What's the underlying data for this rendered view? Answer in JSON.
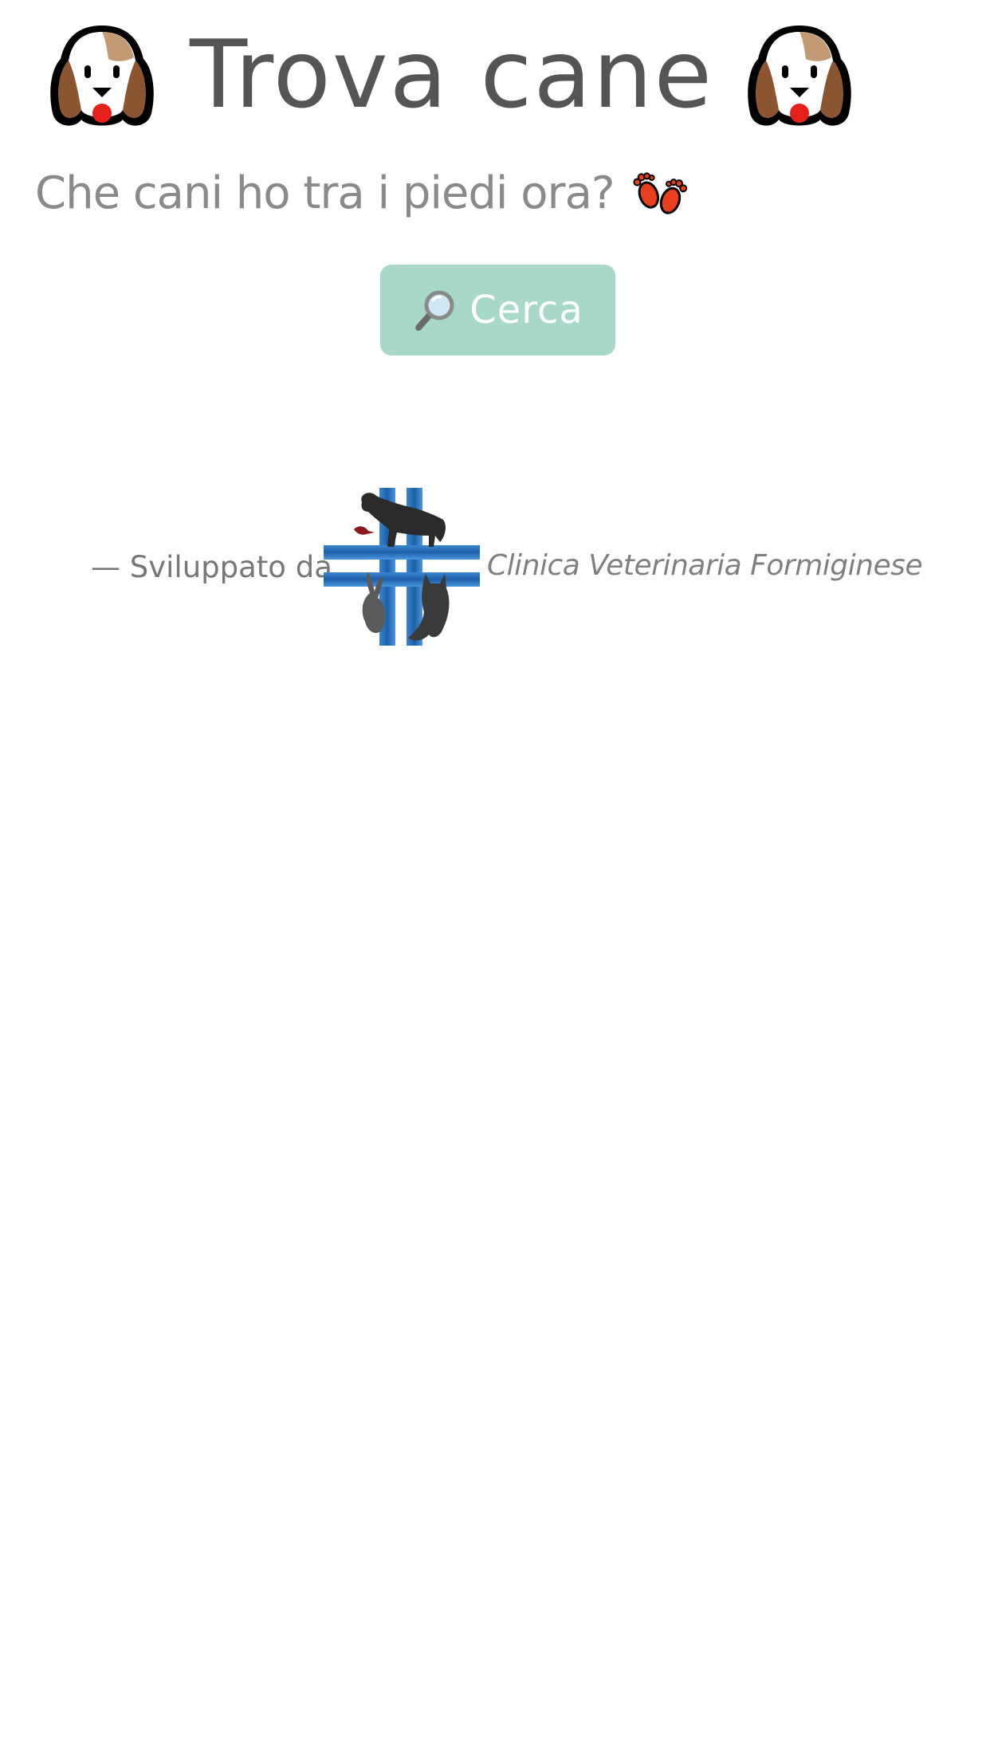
{
  "header": {
    "title": "Trova cane",
    "left_icon": "dog-face-icon",
    "right_icon": "dog-face-icon"
  },
  "subtitle": {
    "text": "Che cani ho tra i piedi ora?",
    "icon": "footprints-icon"
  },
  "search_button": {
    "label": "Cerca",
    "icon": "magnifier-icon",
    "background_color": "#a8d8c8",
    "text_color": "#ffffff"
  },
  "footer": {
    "credit_prefix": "— Sviluppato da",
    "clinic_name": "Clinica Veterinaria Formiginese",
    "logo_icon": "clinic-cross-logo"
  }
}
